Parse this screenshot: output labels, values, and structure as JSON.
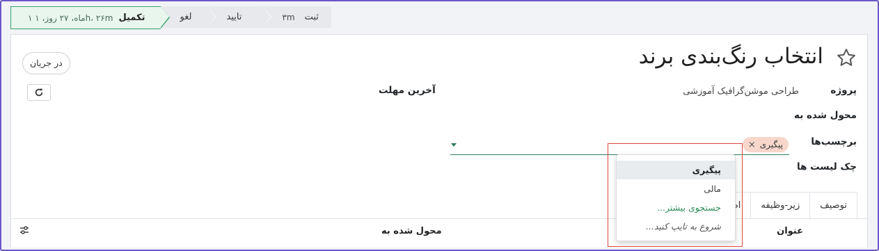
{
  "statusbar": {
    "stages": [
      {
        "name": "تکمیل",
        "duration": "۱ ماه، ۲۷ روز، ۱h، ۲۶m",
        "active": true
      },
      {
        "name": "لغو",
        "duration": ""
      },
      {
        "name": "تایید",
        "duration": ""
      },
      {
        "name": "ثبت",
        "duration": "۳m"
      }
    ]
  },
  "header": {
    "title": "انتخاب رنگ‌بندی برند",
    "state_button": "در جریان"
  },
  "fields": {
    "project_label": "پروژه",
    "project_value": "طراحی موشن‌گرافیک آموزشی",
    "assignee_label": "محول شده به",
    "tags_label": "برچسب‌ها",
    "checklist_label": "چک لیست ها",
    "deadline_label": "آخرین مهلت",
    "tag": "پیگیری"
  },
  "dropdown": {
    "items": [
      {
        "label": "پیگیری",
        "kind": "selected"
      },
      {
        "label": "مالی",
        "kind": "normal"
      },
      {
        "label": "جستجوی بیشتر...",
        "kind": "more"
      },
      {
        "label": "شروع به تایپ کنید...",
        "kind": "hint"
      }
    ]
  },
  "tabs": [
    "توصیف",
    "زیر-وظیفه",
    "اطلاعات اضافی"
  ],
  "table": {
    "col_title": "عنوان",
    "col_assignee": "محول شده به"
  },
  "colors": {
    "accent": "#2f7d5a",
    "frame": "#6d57c7",
    "highlight": "#e0453f",
    "tag_bg": "#f7d7cc"
  }
}
